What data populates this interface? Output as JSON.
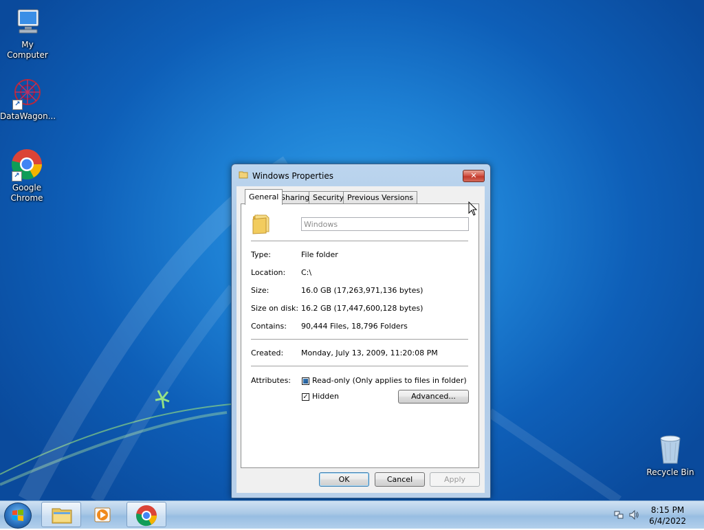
{
  "desktop": {
    "icons": [
      {
        "label": "My Computer"
      },
      {
        "label": "DataWagon..."
      },
      {
        "label": "Google Chrome"
      },
      {
        "label": "Recycle Bin"
      }
    ]
  },
  "dialog": {
    "title": "Windows Properties",
    "close_glyph": "✕",
    "tabs": [
      {
        "label": "General",
        "active": true
      },
      {
        "label": "Sharing"
      },
      {
        "label": "Security"
      },
      {
        "label": "Previous Versions"
      }
    ],
    "name_value": "Windows",
    "properties": {
      "type": {
        "label": "Type:",
        "value": "File folder"
      },
      "location": {
        "label": "Location:",
        "value": "C:\\"
      },
      "size": {
        "label": "Size:",
        "value": "16.0 GB (17,263,971,136 bytes)"
      },
      "size_on_disk": {
        "label": "Size on disk:",
        "value": "16.2 GB (17,447,600,128 bytes)"
      },
      "contains": {
        "label": "Contains:",
        "value": "90,444 Files, 18,796 Folders"
      },
      "created": {
        "label": "Created:",
        "value": "Monday, July 13, 2009, 11:20:08 PM"
      }
    },
    "attributes": {
      "label": "Attributes:",
      "readonly": {
        "label": "Read-only (Only applies to files in folder)",
        "state": "indeterminate"
      },
      "hidden": {
        "label": "Hidden",
        "state": "checked",
        "glyph": "✓"
      },
      "advanced_label": "Advanced..."
    },
    "buttons": {
      "ok": "OK",
      "cancel": "Cancel",
      "apply": "Apply"
    }
  },
  "taskbar": {
    "items": [
      "windows-explorer",
      "media-player",
      "google-chrome"
    ],
    "clock": {
      "time": "8:15 PM",
      "date": "6/4/2022"
    }
  },
  "colors": {
    "desktop_blue": "#1d7fd3",
    "close_red": "#c23a2b",
    "dialog_frame": "#a9c7e6"
  }
}
